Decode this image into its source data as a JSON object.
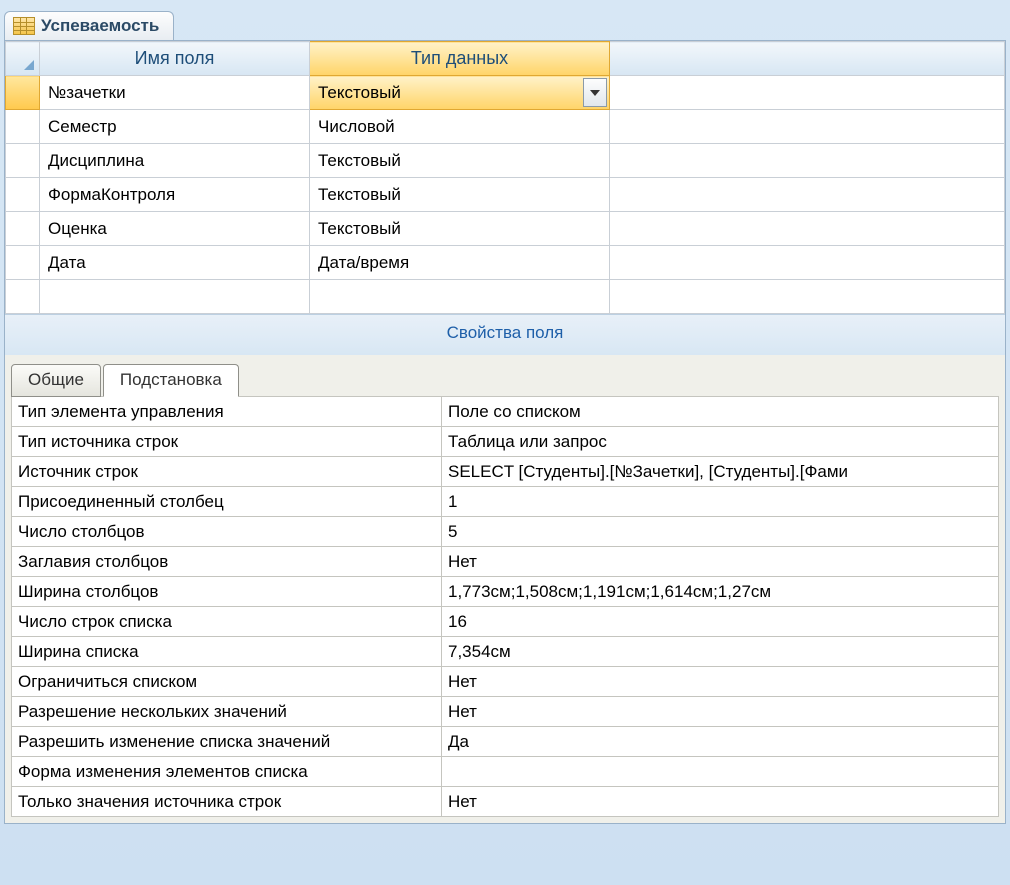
{
  "tab_title": "Успеваемость",
  "grid": {
    "col_name": "Имя поля",
    "col_type": "Тип данных",
    "rows": [
      {
        "name": "№зачетки",
        "type": "Текстовый",
        "selected": true
      },
      {
        "name": "Семестр",
        "type": "Числовой",
        "selected": false
      },
      {
        "name": "Дисциплина",
        "type": "Текстовый",
        "selected": false
      },
      {
        "name": "ФормаКонтроля",
        "type": "Текстовый",
        "selected": false
      },
      {
        "name": "Оценка",
        "type": "Текстовый",
        "selected": false
      },
      {
        "name": "Дата",
        "type": "Дата/время",
        "selected": false
      }
    ]
  },
  "properties_heading": "Свойства поля",
  "tabs": {
    "general": "Общие",
    "lookup": "Подстановка"
  },
  "lookup_props": [
    {
      "label": "Тип элемента управления",
      "value": "Поле со списком"
    },
    {
      "label": "Тип источника строк",
      "value": "Таблица или запрос"
    },
    {
      "label": "Источник строк",
      "value": "SELECT [Студенты].[№Зачетки], [Студенты].[Фами"
    },
    {
      "label": "Присоединенный столбец",
      "value": "1"
    },
    {
      "label": "Число столбцов",
      "value": "5"
    },
    {
      "label": "Заглавия столбцов",
      "value": "Нет"
    },
    {
      "label": "Ширина столбцов",
      "value": "1,773см;1,508см;1,191см;1,614см;1,27см"
    },
    {
      "label": "Число строк списка",
      "value": "16"
    },
    {
      "label": "Ширина списка",
      "value": "7,354см"
    },
    {
      "label": "Ограничиться списком",
      "value": "Нет"
    },
    {
      "label": "Разрешение нескольких значений",
      "value": "Нет"
    },
    {
      "label": "Разрешить изменение списка значений",
      "value": "Да"
    },
    {
      "label": "Форма изменения элементов списка",
      "value": ""
    },
    {
      "label": "Только значения источника строк",
      "value": "Нет"
    }
  ]
}
